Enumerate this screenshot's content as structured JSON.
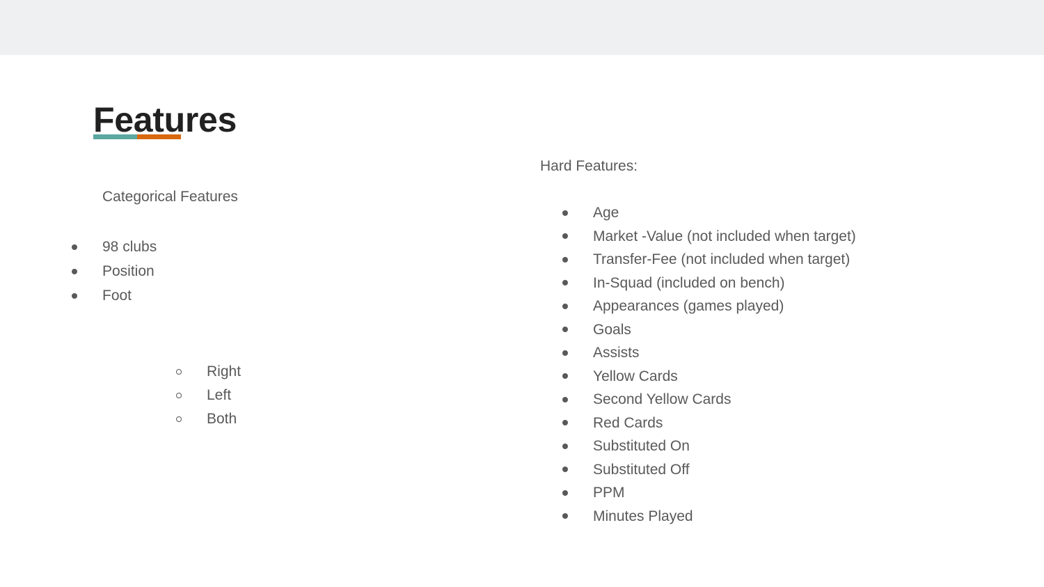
{
  "slide": {
    "title": "Features",
    "accent": {
      "teal": "#5aa8a0",
      "orange": "#d9690f"
    },
    "text_color": "#595959",
    "title_color": "#212121",
    "band_color": "#eff0f1"
  },
  "left_column": {
    "heading": "Categorical Features",
    "items": [
      {
        "label": "98 clubs"
      },
      {
        "label": "Position"
      },
      {
        "label": "Foot"
      }
    ],
    "sub_items": [
      {
        "label": "Right"
      },
      {
        "label": "Left"
      },
      {
        "label": "Both"
      }
    ]
  },
  "right_column": {
    "heading": "Hard Features:",
    "items": [
      {
        "label": "Age"
      },
      {
        "label": "Market -Value (not included when target)"
      },
      {
        "label": "Transfer-Fee (not included when target)"
      },
      {
        "label": "In-Squad (included on bench)"
      },
      {
        "label": "Appearances (games played)"
      },
      {
        "label": "Goals"
      },
      {
        "label": "Assists"
      },
      {
        "label": "Yellow Cards"
      },
      {
        "label": "Second Yellow Cards"
      },
      {
        "label": "Red Cards"
      },
      {
        "label": "Substituted On"
      },
      {
        "label": "Substituted Off"
      },
      {
        "label": "PPM"
      },
      {
        "label": "Minutes Played"
      }
    ]
  }
}
